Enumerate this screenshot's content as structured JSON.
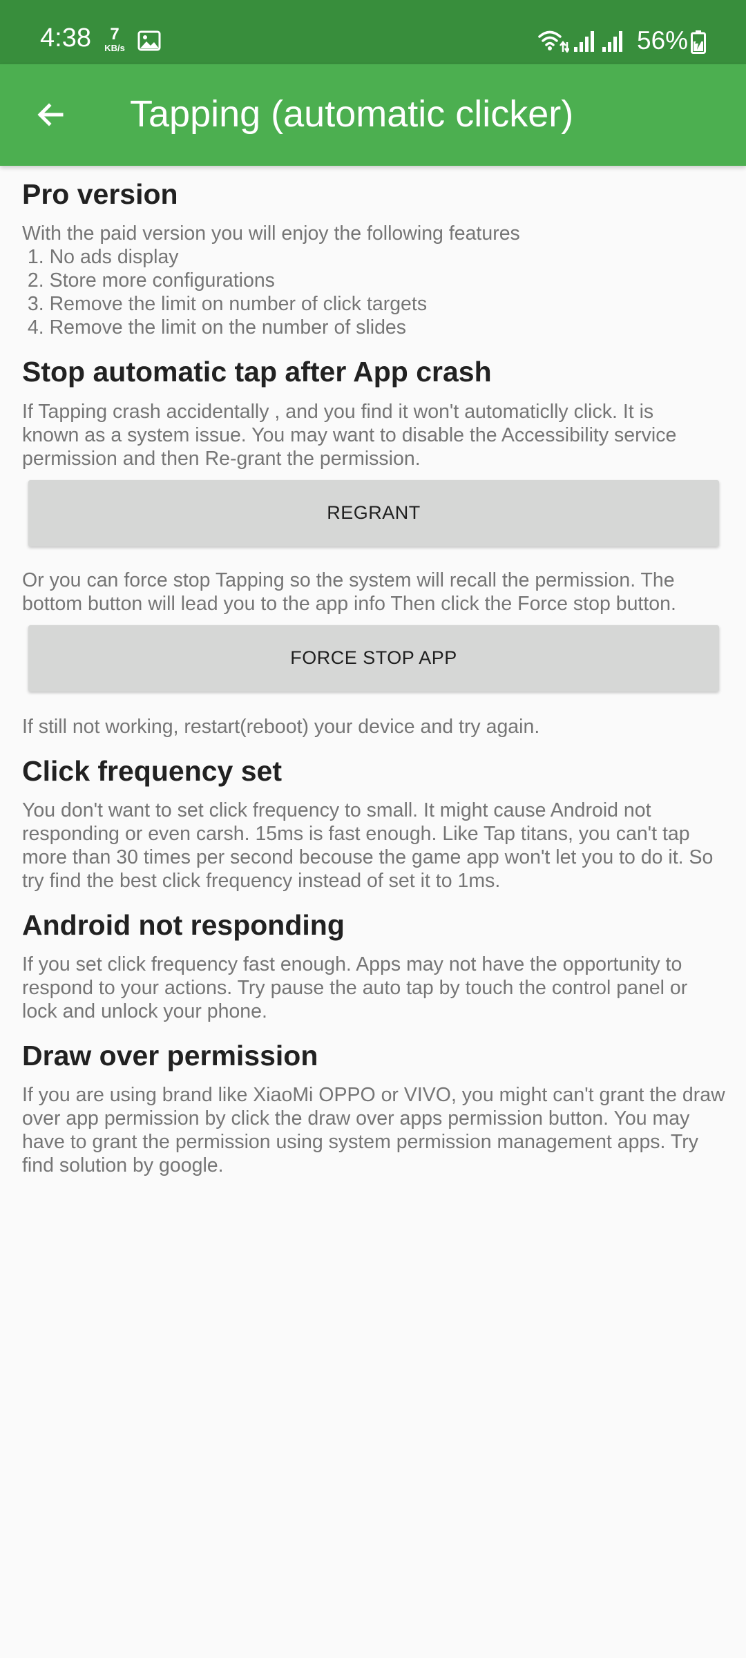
{
  "status_bar": {
    "time": "4:38",
    "net_speed_value": "7",
    "net_speed_unit": "KB/s",
    "battery": "56%",
    "icons": [
      "gallery-icon",
      "wifi-icon",
      "signal-icon",
      "signal-icon",
      "battery-charging-icon"
    ]
  },
  "app_bar": {
    "title": "Tapping (automatic clicker)",
    "back_icon": "arrow-back-icon",
    "color": "#4caf50",
    "status_color": "#388e3c"
  },
  "sections": {
    "pro": {
      "title": "Pro version",
      "lines": [
        "With the paid version you will enjoy the following features",
        " 1. No ads display",
        " 2. Store more configurations",
        " 3. Remove the limit on number of click targets",
        " 4. Remove the limit on the number of slides"
      ]
    },
    "stop": {
      "title": "Stop automatic tap after App crash",
      "lines": [
        "If Tapping crash accidentally , and you find it won't automaticlly click. It is",
        "known as a system issue. You may want to disable the Accessibility service",
        "permission and then Re-grant the permission."
      ],
      "regrant_button": "REGRANT",
      "force_lines": [
        "Or you can force stop Tapping so the system will recall the permission. The",
        "bottom button will lead you to the app info Then click the Force stop button."
      ],
      "force_stop_button": "FORCE STOP APP",
      "reboot_line": "If still not working, restart(reboot) your device and try again."
    },
    "frequency": {
      "title": "Click frequency set",
      "lines": [
        "You don't want to set click frequency to small. It might cause Android not",
        "responding or even carsh. 15ms is fast enough. Like Tap titans, you can't tap",
        "more than 30 times per second becouse the game app won't let you to do it. So",
        "try find the best click frequency instead of set it to 1ms."
      ]
    },
    "anr": {
      "title": "Android not responding",
      "lines": [
        "If you set click frequency fast enough. Apps may not have the opportunity to",
        "respond to your actions. Try pause the auto tap by touch the control panel or",
        "lock and unlock your phone."
      ]
    },
    "draw": {
      "title": "Draw over permission",
      "lines": [
        "If you are using brand like XiaoMi OPPO or VIVO, you might can't grant the draw",
        "over app permission by click the draw over apps permission button. You may",
        "have to grant the permission using system permission management apps. Try",
        "find solution by google."
      ]
    }
  }
}
